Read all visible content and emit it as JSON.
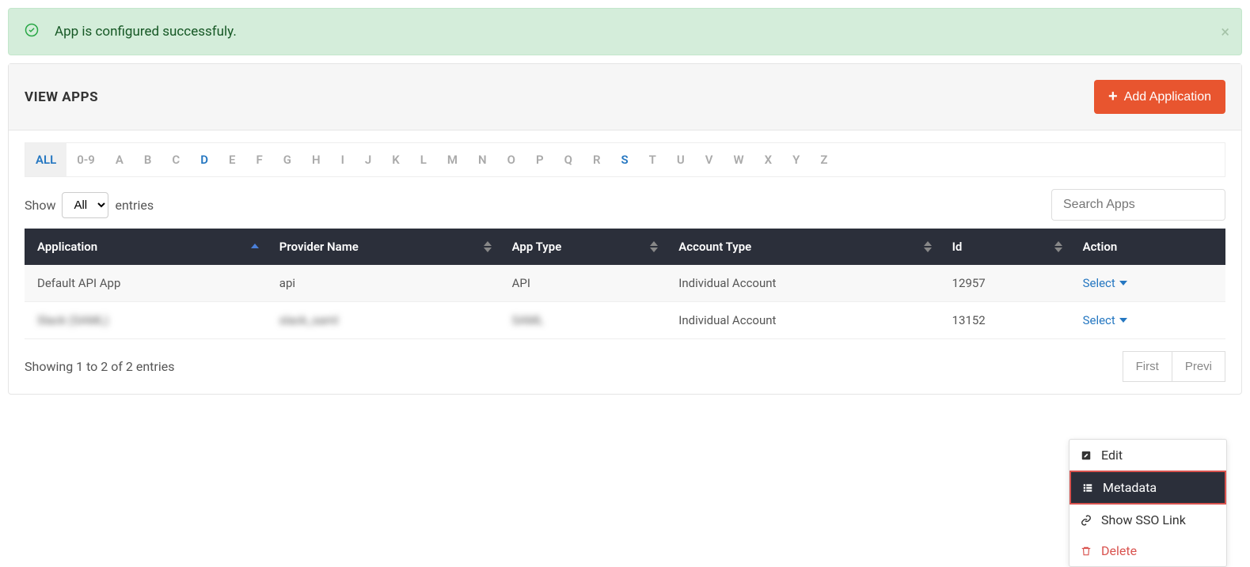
{
  "alert": {
    "text": "App is configured successfuly."
  },
  "panel": {
    "title": "VIEW APPS",
    "add_button": "Add Application"
  },
  "alpha_filter": [
    "ALL",
    "0-9",
    "A",
    "B",
    "C",
    "D",
    "E",
    "F",
    "G",
    "H",
    "I",
    "J",
    "K",
    "L",
    "M",
    "N",
    "O",
    "P",
    "Q",
    "R",
    "S",
    "T",
    "U",
    "V",
    "W",
    "X",
    "Y",
    "Z"
  ],
  "alpha_active": "ALL",
  "alpha_highlight": [
    "D",
    "S"
  ],
  "show_entries": {
    "label_before": "Show",
    "label_after": "entries",
    "value": "All"
  },
  "search": {
    "placeholder": "Search Apps"
  },
  "columns": [
    "Application",
    "Provider Name",
    "App Type",
    "Account Type",
    "Id",
    "Action"
  ],
  "rows": [
    {
      "application": "Default API App",
      "provider": "api",
      "app_type": "API",
      "account_type": "Individual Account",
      "id": "12957",
      "action": "Select",
      "blurred": false
    },
    {
      "application": "Slack (SAML)",
      "provider": "slack_saml",
      "app_type": "SAML",
      "account_type": "Individual Account",
      "id": "13152",
      "action": "Select",
      "blurred": true
    }
  ],
  "footer": {
    "showing": "Showing 1 to 2 of 2 entries"
  },
  "pagination": [
    "First",
    "Previ"
  ],
  "dropdown": {
    "edit": "Edit",
    "metadata": "Metadata",
    "show_sso": "Show SSO Link",
    "delete": "Delete"
  }
}
